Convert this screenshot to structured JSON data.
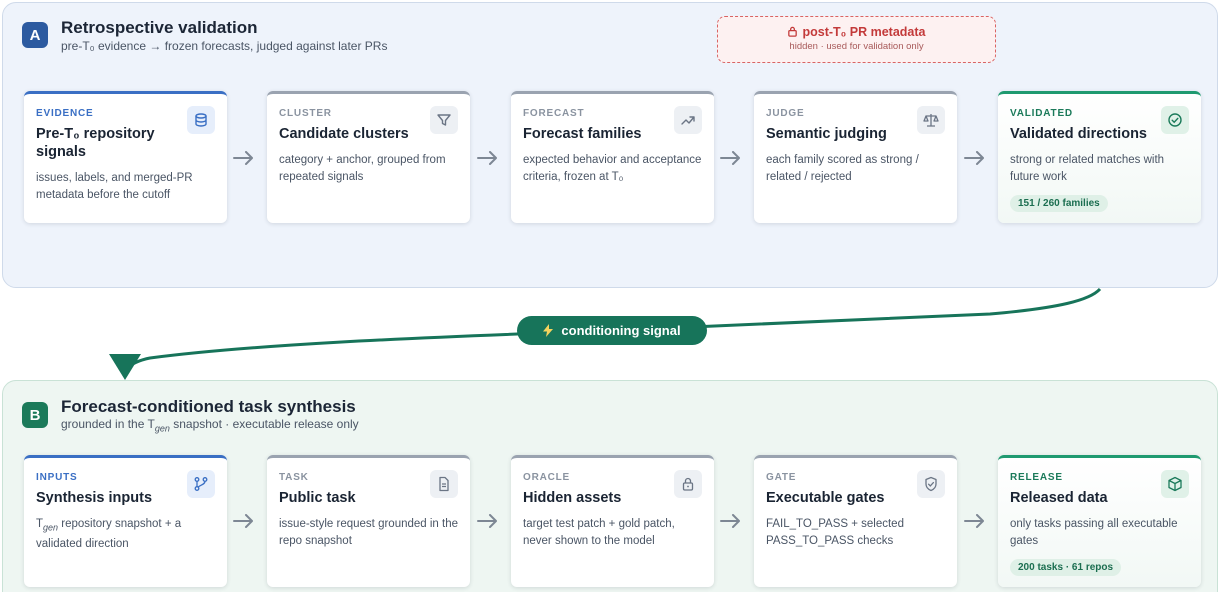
{
  "panel_a": {
    "badge": "A",
    "title": "Retrospective validation",
    "subtitle": "pre-T₀ evidence → frozen forecasts, judged against later PRs",
    "hidden": {
      "title": "post-T₀ PR metadata",
      "subtitle": "hidden · used for validation only",
      "icon": "lock-icon",
      "color": "#c33a3a"
    },
    "cards": [
      {
        "kicker": "EVIDENCE",
        "title": "Pre-T₀ repository signals",
        "desc": "issues, labels, and merged-PR metadata before the cutoff",
        "icon": "database-icon",
        "pill": ""
      },
      {
        "kicker": "CLUSTER",
        "title": "Candidate clusters",
        "desc": "category + anchor, grouped from repeated signals",
        "icon": "filter-icon",
        "pill": ""
      },
      {
        "kicker": "FORECAST",
        "title": "Forecast families",
        "desc": "expected behavior and acceptance criteria, frozen at T₀",
        "icon": "trend-up-icon",
        "pill": ""
      },
      {
        "kicker": "JUDGE",
        "title": "Semantic judging",
        "desc": "each family scored as strong / related / rejected",
        "icon": "scale-icon",
        "pill": ""
      },
      {
        "kicker": "VALIDATED",
        "title": "Validated directions",
        "desc": "strong or related matches with future work",
        "icon": "check-circle-icon",
        "pill": "151 / 260 families"
      }
    ]
  },
  "connector": {
    "label": "conditioning signal",
    "icon": "bolt-icon",
    "color": "#17745a"
  },
  "panel_b": {
    "badge": "B",
    "title": "Forecast-conditioned task synthesis",
    "subtitle_pre": "grounded in the T",
    "subtitle_sub": "gen",
    "subtitle_post": " snapshot · executable release only",
    "cards": [
      {
        "kicker": "INPUTS",
        "title": "Synthesis inputs",
        "desc_pre": "T",
        "desc_sub": "gen",
        "desc_post": " repository snapshot + a validated direction",
        "icon": "branch-icon",
        "pill": ""
      },
      {
        "kicker": "TASK",
        "title": "Public task",
        "desc": "issue-style request grounded in the repo snapshot",
        "icon": "document-icon",
        "pill": ""
      },
      {
        "kicker": "ORACLE",
        "title": "Hidden assets",
        "desc": "target test patch + gold patch, never shown to the model",
        "icon": "lock-icon",
        "pill": ""
      },
      {
        "kicker": "GATE",
        "title": "Executable gates",
        "desc": "FAIL_TO_PASS + selected PASS_TO_PASS checks",
        "icon": "shield-check-icon",
        "pill": ""
      },
      {
        "kicker": "RELEASE",
        "title": "Released data",
        "desc": "only tasks passing all executable gates",
        "icon": "package-icon",
        "pill": "200 tasks · 61 repos"
      }
    ]
  },
  "colors": {
    "blue_accent": "#3a6fc4",
    "green_accent": "#1f9a70",
    "gray_accent": "#9aa3b0",
    "badge_a": "#2c5aa0",
    "badge_b": "#1b7a5a"
  }
}
